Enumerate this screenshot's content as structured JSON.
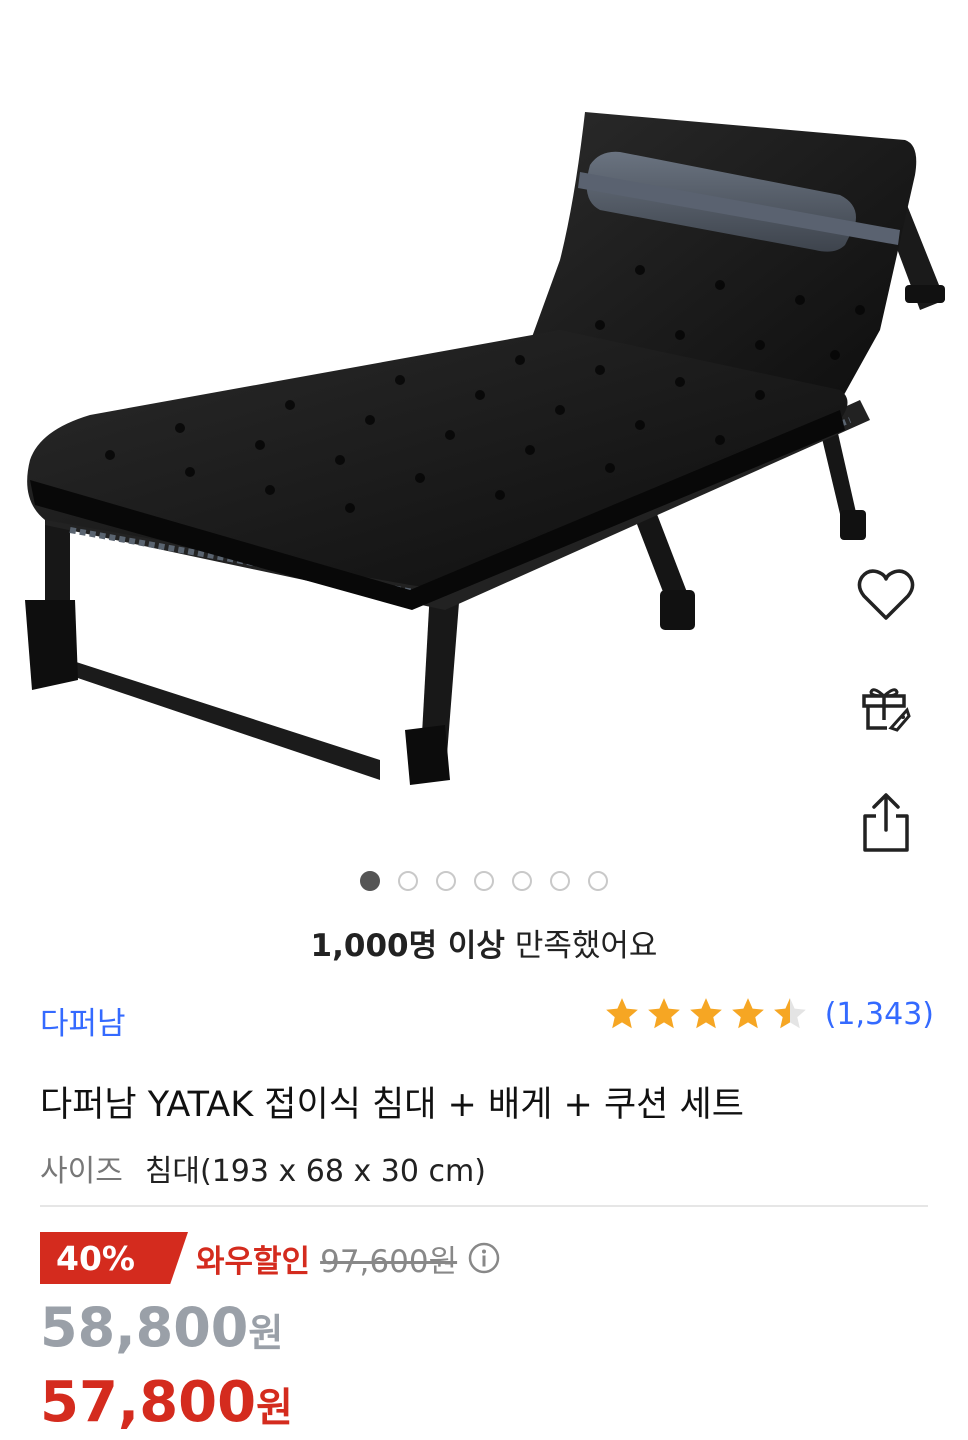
{
  "product_image": {
    "alt": "folding bed with cushion and pillow",
    "dots": 7,
    "active_index": 0
  },
  "side_actions": {
    "favorite_icon": "heart-icon",
    "gift_icon": "gift-icon",
    "share_icon": "share-icon"
  },
  "satisfaction": {
    "count_text": "1,000명 이상",
    "suffix_text": " 만족했어요"
  },
  "brand": "다퍼남",
  "rating": {
    "stars": 4.5,
    "count": "(1,343)",
    "star_color": "#f6a623"
  },
  "title": "다퍼남 YATAK 접이식 침대 + 배게 + 쿠션 세트",
  "option": {
    "label": "사이즈",
    "value": "침대(193 x 68 x 30 cm)"
  },
  "pricing": {
    "discount_percent": "40%",
    "wow_label": "와우할인",
    "original_price": "97,600원",
    "price": "58,800",
    "price_unit": "원",
    "wow_price": "57,800",
    "wow_price_unit": "원",
    "accent_color": "#d42b1e"
  }
}
